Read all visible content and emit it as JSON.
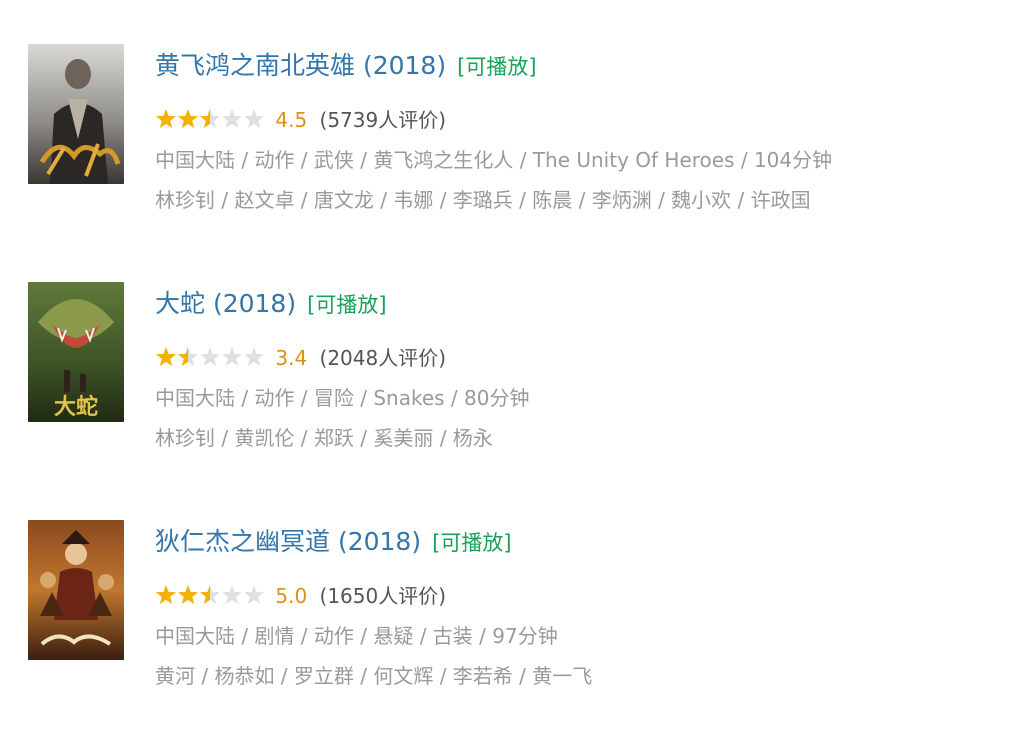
{
  "colors": {
    "title": "#3377aa",
    "playable": "#1aa15a",
    "score": "#e09015",
    "star_on": "#f5b100",
    "star_off": "#e0e0e0",
    "meta": "#9a9a9a"
  },
  "movies": [
    {
      "title": "黄飞鸿之南北英雄 (2018)",
      "playable": "[可播放]",
      "rating": 2.5,
      "score": "4.5",
      "count": "(5739人评价)",
      "info": "中国大陆 / 动作 / 武侠 / 黄飞鸿之生化人 / The Unity Of Heroes / 104分钟",
      "cast": "林珍钊 / 赵文卓 / 唐文龙 / 韦娜 / 李璐兵 / 陈晨 / 李炳渊 / 魏小欢 / 许政国",
      "poster_icon": "movie-poster-martial-arts"
    },
    {
      "title": "大蛇 (2018)",
      "playable": "[可播放]",
      "rating": 1.5,
      "score": "3.4",
      "count": "(2048人评价)",
      "info": "中国大陆 / 动作 / 冒险 / Snakes / 80分钟",
      "cast": "林珍钊 / 黄凯伦 / 郑跃 / 奚美丽 / 杨永",
      "poster_icon": "movie-poster-snake"
    },
    {
      "title": "狄仁杰之幽冥道 (2018)",
      "playable": "[可播放]",
      "rating": 2.5,
      "score": "5.0",
      "count": "(1650人评价)",
      "info": "中国大陆 / 剧情 / 动作 / 悬疑 / 古装 / 97分钟",
      "cast": "黄河 / 杨恭如 / 罗立群 / 何文辉 / 李若希 / 黄一飞",
      "poster_icon": "movie-poster-ancient-drama"
    }
  ]
}
